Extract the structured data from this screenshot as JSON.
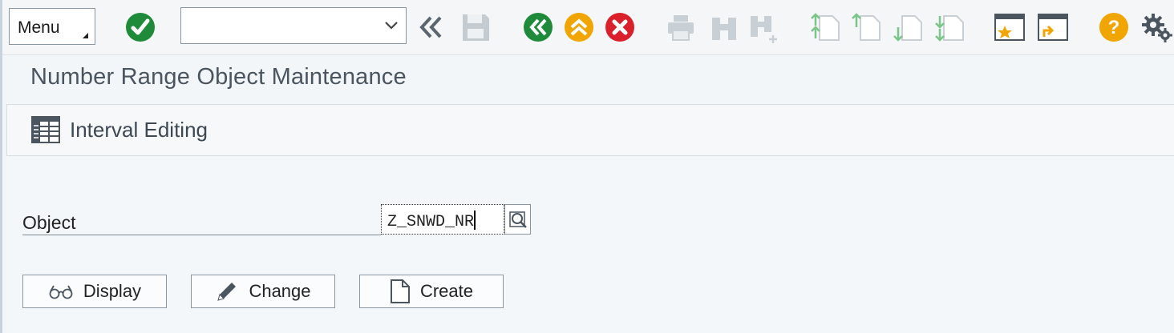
{
  "toolbar": {
    "menu_label": "Menu",
    "command_field_value": "",
    "icons": [
      "enter-icon",
      "dropdown-icon",
      "collapse-icon",
      "save-icon",
      "back-icon",
      "exit-icon",
      "cancel-icon",
      "print-icon",
      "find-icon",
      "find-next-icon",
      "first-page-icon",
      "previous-page-icon",
      "next-page-icon",
      "last-page-icon",
      "new-session-icon",
      "shortcut-icon",
      "help-icon",
      "settings-icon"
    ],
    "colors": {
      "enter": "#1f8a3a",
      "back": "#1f8a3a",
      "exit": "#f0a500",
      "cancel": "#d9202b",
      "help": "#f0a500"
    }
  },
  "title": "Number Range Object Maintenance",
  "app_toolbar": {
    "interval_editing_label": "Interval Editing"
  },
  "form": {
    "object_label": "Object",
    "object_value": "Z_SNWD_NR"
  },
  "buttons": {
    "display": "Display",
    "change": "Change",
    "create": "Create"
  }
}
